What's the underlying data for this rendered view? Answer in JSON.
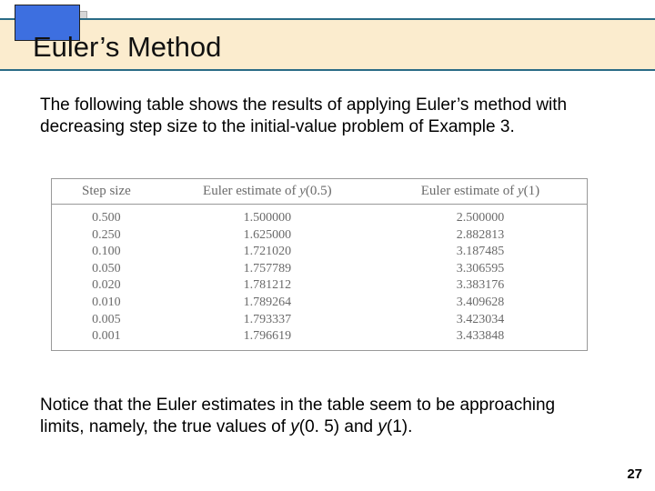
{
  "title": "Euler’s Method",
  "para1": "The following table shows the results of applying Euler’s method with decreasing step size to the initial-value problem of Example 3.",
  "para2_prefix": "Notice that the Euler estimates in the table seem to be approaching limits, namely, the true values of ",
  "y05": "y",
  "y05_arg": "(0. 5)",
  "and": " and ",
  "y1": "y",
  "y1_arg": "(1).",
  "chart_data": {
    "type": "table",
    "title": "Euler estimates with decreasing step size",
    "headers": {
      "step": "Step size",
      "y05_prefix": "Euler estimate of ",
      "y05_var": "y",
      "y05_arg": "(0.5)",
      "y1_prefix": "Euler estimate of ",
      "y1_var": "y",
      "y1_arg": "(1)"
    },
    "rows": [
      {
        "step": "0.500",
        "y05": "1.500000",
        "y1": "2.500000"
      },
      {
        "step": "0.250",
        "y05": "1.625000",
        "y1": "2.882813"
      },
      {
        "step": "0.100",
        "y05": "1.721020",
        "y1": "3.187485"
      },
      {
        "step": "0.050",
        "y05": "1.757789",
        "y1": "3.306595"
      },
      {
        "step": "0.020",
        "y05": "1.781212",
        "y1": "3.383176"
      },
      {
        "step": "0.010",
        "y05": "1.789264",
        "y1": "3.409628"
      },
      {
        "step": "0.005",
        "y05": "1.793337",
        "y1": "3.423034"
      },
      {
        "step": "0.001",
        "y05": "1.796619",
        "y1": "3.433848"
      }
    ]
  },
  "page_number": "27"
}
